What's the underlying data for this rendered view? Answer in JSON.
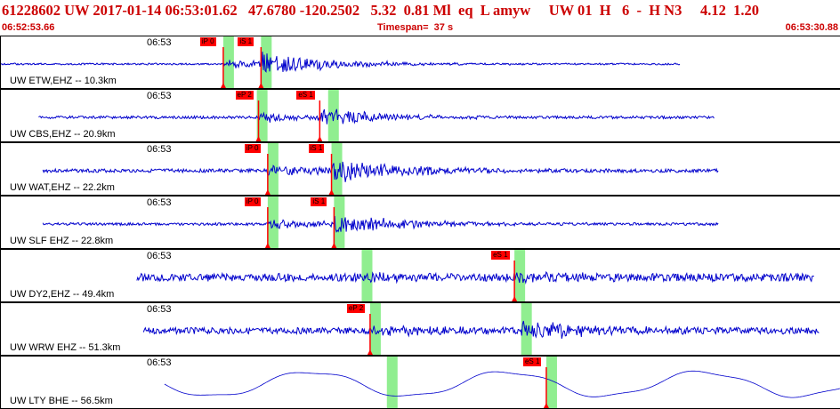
{
  "header": {
    "title": "61228602 UW 2017-01-14 06:53:01.62   47.6780 -120.2502   5.32  0.81 Ml  eq  L amyw     UW 01  H   6  -  H N3     4.12  1.20",
    "start_time": "06:52:53.66",
    "timespan": "Timespan=  37 s",
    "end_time": "06:53:30.88"
  },
  "colors": {
    "header_text": "#cc0000",
    "trace": "#0000cc",
    "pick": "#ff0000",
    "window": "#90ee90"
  },
  "panels": [
    {
      "station": "UW ETW,EHZ -- 10.3km",
      "time_label": "06:53",
      "amp": 4,
      "seed": 1,
      "start": 0.0,
      "end": 0.81,
      "p": 0.265,
      "s": 0.31,
      "decay": 0.08,
      "burst": 25,
      "noise": 2,
      "green": [
        0.265,
        0.31
      ],
      "picks": [
        {
          "label": "iP 0",
          "t": 0.265
        },
        {
          "label": "iS 1",
          "t": 0.31
        }
      ]
    },
    {
      "station": "UW CBS,EHZ -- 20.9km",
      "time_label": "06:53",
      "amp": 3,
      "seed": 2,
      "start": 0.045,
      "end": 0.85,
      "p": 0.307,
      "s": 0.38,
      "decay": 0.07,
      "burst": 22,
      "noise": 3,
      "green": [
        0.305,
        0.39
      ],
      "picks": [
        {
          "label": "eP 2",
          "t": 0.307
        },
        {
          "label": "eS 1",
          "t": 0.38
        }
      ]
    },
    {
      "station": "UW WAT,EHZ -- 22.2km",
      "time_label": "06:53",
      "amp": 3,
      "seed": 3,
      "start": 0.05,
      "end": 0.855,
      "p": 0.318,
      "s": 0.394,
      "decay": 0.09,
      "burst": 24,
      "noise": 4,
      "green": [
        0.318,
        0.394
      ],
      "picks": [
        {
          "label": "iP 0",
          "t": 0.318
        },
        {
          "label": "iS 1",
          "t": 0.394
        }
      ]
    },
    {
      "station": "UW SLF EHZ -- 22.8km",
      "time_label": "06:53",
      "amp": 3,
      "seed": 4,
      "start": 0.05,
      "end": 0.855,
      "p": 0.318,
      "s": 0.397,
      "decay": 0.09,
      "burst": 20,
      "noise": 3,
      "green": [
        0.318,
        0.397
      ],
      "picks": [
        {
          "label": "iP 0",
          "t": 0.318
        },
        {
          "label": "iS 1",
          "t": 0.397
        }
      ]
    },
    {
      "station": "UW DY2,EHZ -- 49.4km",
      "time_label": "06:53",
      "amp": 3,
      "seed": 5,
      "start": 0.162,
      "end": 0.97,
      "p": 0.43,
      "s": 0.612,
      "decay": 0.05,
      "burst": 12,
      "noise": 9,
      "green": [
        0.43,
        0.612
      ],
      "picks": [
        {
          "label": "eS 1",
          "t": 0.612
        }
      ]
    },
    {
      "station": "UW WRW EHZ -- 51.3km",
      "time_label": "06:53",
      "amp": 3,
      "seed": 6,
      "start": 0.17,
      "end": 0.975,
      "p": 0.44,
      "s": 0.62,
      "decay": 0.1,
      "burst": 18,
      "noise": 7,
      "green": [
        0.44,
        0.62
      ],
      "picks": [
        {
          "label": "eP 2",
          "t": 0.44
        }
      ]
    },
    {
      "station": "UW LTY BHE -- 56.5km",
      "time_label": "06:53",
      "amp": 3,
      "seed": 7,
      "start": 0.195,
      "end": 1.0,
      "p": 0.46,
      "s": 0.65,
      "decay": 0.3,
      "burst": 0,
      "noise": 0,
      "green": [
        0.46,
        0.65
      ],
      "picks": [
        {
          "label": "eS 1",
          "t": 0.65
        }
      ]
    }
  ]
}
